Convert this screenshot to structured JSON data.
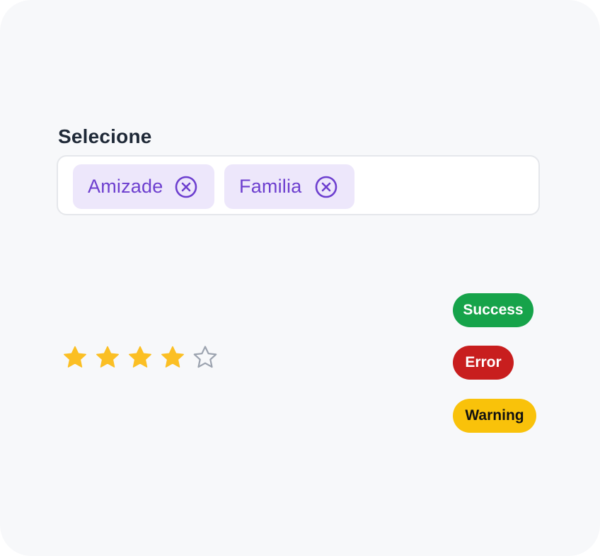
{
  "select": {
    "label": "Selecione",
    "chips": [
      {
        "label": "Amizade",
        "remove_icon": "close-circle-icon"
      },
      {
        "label": "Familia",
        "remove_icon": "close-circle-icon"
      }
    ]
  },
  "rating": {
    "value": 4,
    "max": 5,
    "icon": "star-icon"
  },
  "badges": {
    "success": "Success",
    "error": "Error",
    "warning": "Warning"
  },
  "colors": {
    "card_background": "#f7f8fa",
    "chip_background": "#ede7fb",
    "chip_text": "#6d3fcf",
    "star_filled": "#fbbf24",
    "star_empty": "#9ca3af",
    "success": "#16a34a",
    "error": "#c81e1e",
    "warning": "#f9c20a"
  }
}
